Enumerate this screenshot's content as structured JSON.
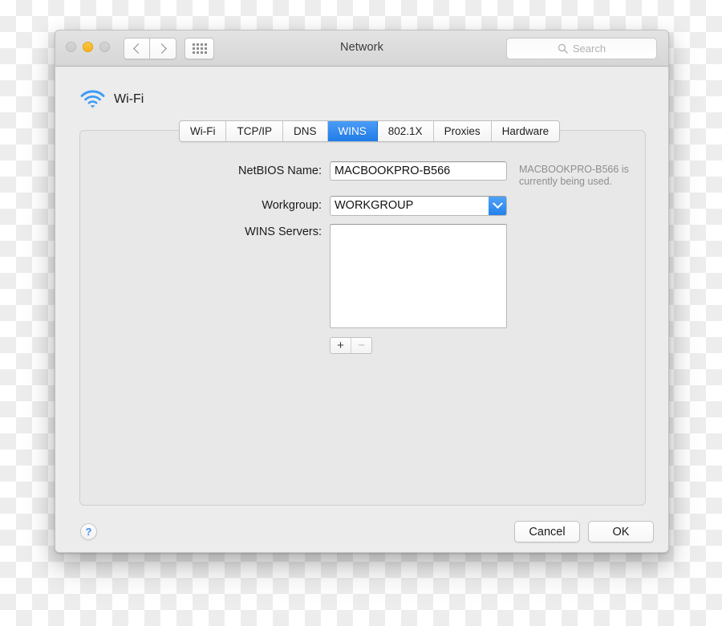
{
  "window": {
    "title": "Network",
    "traffic_lights": [
      {
        "name": "close",
        "state": "inactive",
        "color": "#d2d2d2"
      },
      {
        "name": "minimize",
        "state": "active",
        "color": "#f6b21b"
      },
      {
        "name": "zoom",
        "state": "inactive",
        "color": "#d2d2d2"
      }
    ],
    "toolbar": {
      "back_icon": "chevron-left-icon",
      "forward_icon": "chevron-right-icon",
      "showall_icon": "grid-icon"
    },
    "search": {
      "placeholder": "Search",
      "value": "",
      "icon": "search-icon"
    }
  },
  "service": {
    "icon": "wifi-icon",
    "icon_color": "#3d9bf5",
    "name": "Wi-Fi"
  },
  "tabs": [
    {
      "label": "Wi-Fi",
      "selected": false
    },
    {
      "label": "TCP/IP",
      "selected": false
    },
    {
      "label": "DNS",
      "selected": false
    },
    {
      "label": "WINS",
      "selected": true
    },
    {
      "label": "802.1X",
      "selected": false
    },
    {
      "label": "Proxies",
      "selected": false
    },
    {
      "label": "Hardware",
      "selected": false
    }
  ],
  "selected_tab_color": "#2482ec",
  "form": {
    "netbios": {
      "label": "NetBIOS Name:",
      "value": "MACBOOKPRO-B566",
      "placeholder": "",
      "hint": "MACBOOKPRO-B566 is currently being used."
    },
    "workgroup": {
      "label": "Workgroup:",
      "value": "WORKGROUP",
      "placeholder": "",
      "dropdown_icon": "chevron-down-icon"
    },
    "wins_servers": {
      "label": "WINS Servers:",
      "items": [],
      "add_label": "+",
      "remove_label": "−",
      "remove_enabled": false
    }
  },
  "footer": {
    "help_label": "?",
    "cancel_label": "Cancel",
    "ok_label": "OK"
  }
}
